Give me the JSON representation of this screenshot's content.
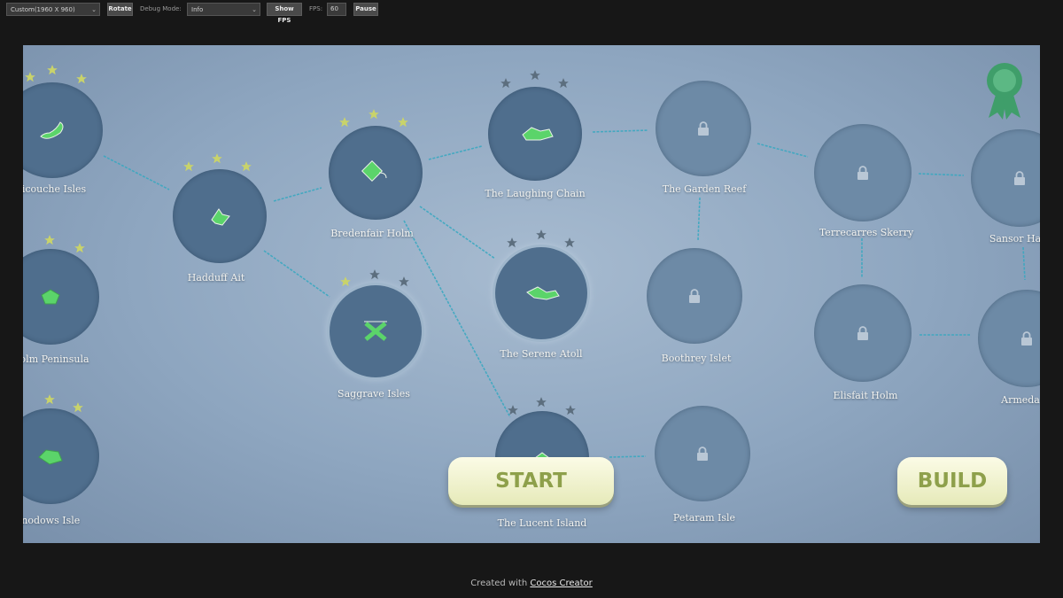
{
  "toolbar": {
    "resolution": "Custom(1960 X 960)",
    "rotate": "Rotate",
    "debug_label": "Debug Mode:",
    "debug_value": "Info",
    "show_fps": "Show FPS",
    "fps_label": "FPS:",
    "fps_value": "60",
    "pause": "Pause"
  },
  "nodes": {
    "malicouche": "alicouche Isles",
    "holm_peninsula": "holm Peninsula",
    "meadows": "anodows Isle",
    "hadduff": "Hadduff Ait",
    "bredenfair": "Bredenfair Holm",
    "saggrave": "Saggrave Isles",
    "laughing": "The Laughing Chain",
    "serene": "The Serene Atoll",
    "lucent": "The Lucent Island",
    "garden": "The Garden Reef",
    "boothrey": "Boothrey Islet",
    "petaram": "Petaram Isle",
    "terrecarres": "Terrecarres Skerry",
    "elisfait": "Elisfait Holm",
    "sansor": "Sansor Ha",
    "armeda": "Armeda"
  },
  "buttons": {
    "start": "START",
    "build": "BUILD"
  },
  "colors": {
    "star_earned": "#c9d36a",
    "star_empty": "#5c6e7e",
    "link": "#36a8c0",
    "ribbon": "#3f9e6a"
  },
  "footer": {
    "prefix": "Created with",
    "link": "Cocos Creator"
  }
}
